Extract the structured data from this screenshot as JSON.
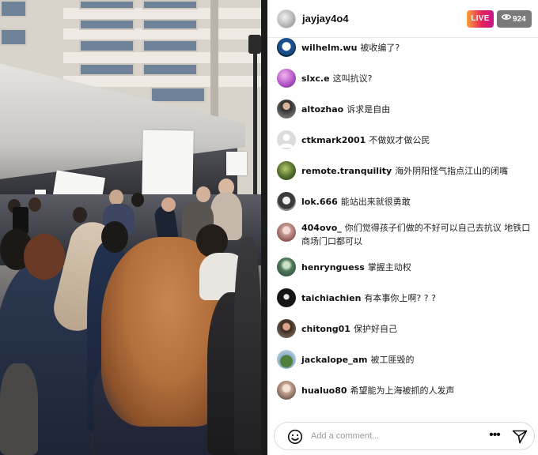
{
  "header": {
    "username": "jayjay4o4",
    "live_label": "LIVE",
    "viewer_count": "924"
  },
  "comments": [
    {
      "user": "wilhelm.wu",
      "text": "被收编了?"
    },
    {
      "user": "slxc.e",
      "text": "这叫抗议?"
    },
    {
      "user": "altozhao",
      "text": "诉求是自由"
    },
    {
      "user": "ctkmark2001",
      "text": "不做奴才做公民"
    },
    {
      "user": "remote.tranquility",
      "text": "海外阴阳怪气指点江山的闭嘴"
    },
    {
      "user": "lok.666",
      "text": "能站出来就很勇敢"
    },
    {
      "user": "404ovo_",
      "text": "你们觉得孩子们做的不好可以自己去抗议 地铁口商场门口都可以"
    },
    {
      "user": "henrynguess",
      "text": "掌握主动权"
    },
    {
      "user": "taichiachien",
      "text": "有本事你上啊? ? ?"
    },
    {
      "user": "chitong01",
      "text": "保护好自己"
    },
    {
      "user": "jackalope_am",
      "text": "被工匪毁的"
    },
    {
      "user": "hualuo80",
      "text": "希望能为上海被抓的人发声"
    }
  ],
  "composer": {
    "placeholder": "Add a comment..."
  },
  "colors": {
    "live_gradient": [
      "#f7a136",
      "#e6245c",
      "#c6158a"
    ],
    "viewer_badge": "#7a7a7a"
  },
  "icons": [
    "eye-icon",
    "emoji-icon",
    "more-icon",
    "send-icon"
  ]
}
